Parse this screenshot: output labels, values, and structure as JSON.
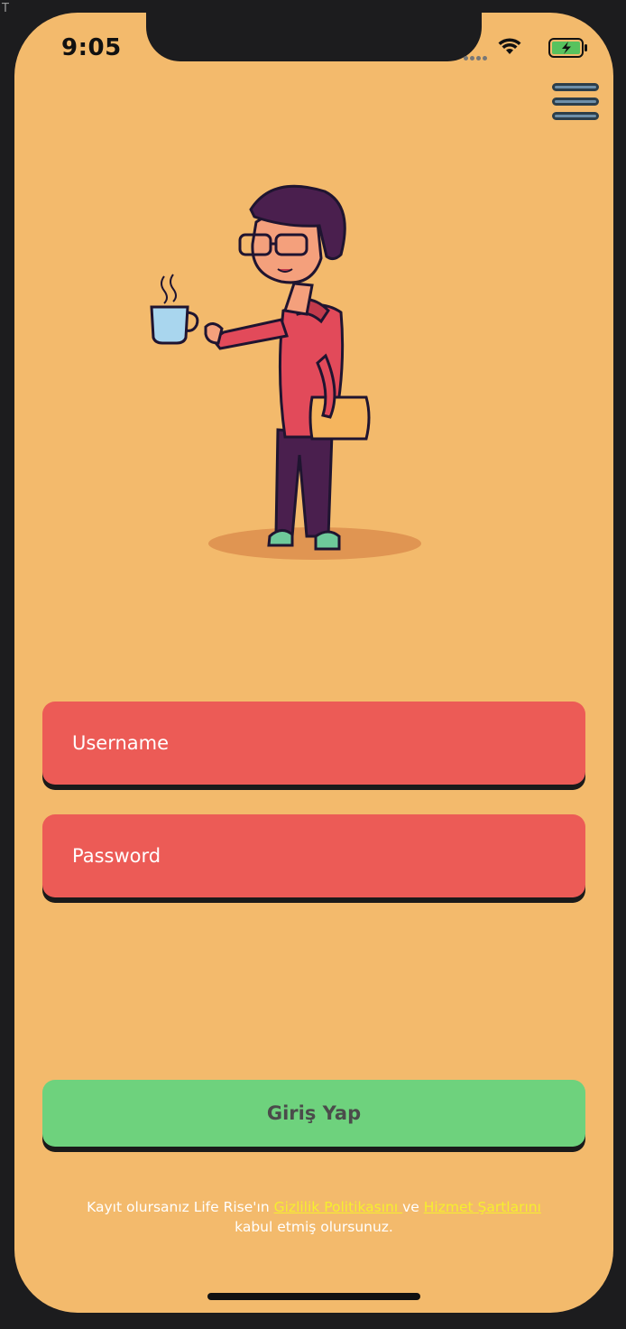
{
  "status_bar": {
    "time": "9:05"
  },
  "corner_char": "T",
  "colors": {
    "background": "#f3ba6c",
    "field": "#ec5b56",
    "button": "#6ed27d",
    "link": "#f6ef2e"
  },
  "login": {
    "username_placeholder": "Username",
    "password_placeholder": "Password",
    "submit_label": "Giriş Yap"
  },
  "legal": {
    "prefix": "Kayıt olursanız Life Rise'ın",
    "privacy_link": " Gizlilik Politikasını ",
    "connector": "ve",
    "terms_link": "Hizmet Şartlarını",
    "suffix": "kabul etmiş olursunuz."
  },
  "icons": [
    "menu-icon",
    "wifi-icon",
    "battery-charging-icon",
    "signal-icon"
  ]
}
